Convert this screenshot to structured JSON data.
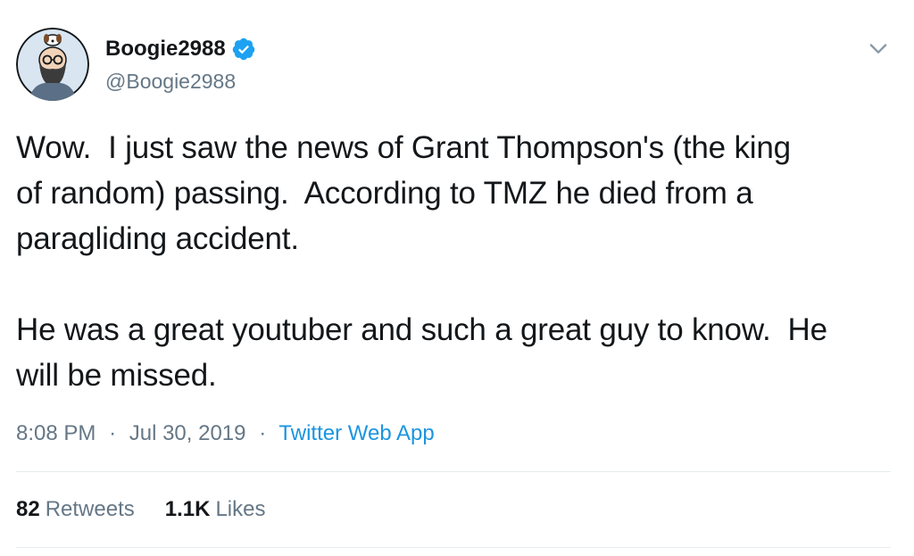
{
  "user": {
    "display_name": "Boogie2988",
    "handle": "@Boogie2988",
    "verified": true
  },
  "tweet": {
    "text": "Wow.  I just saw the news of Grant Thompson's (the king\nof random) passing.  According to TMZ he died from a\nparagliding accident.\n\nHe was a great youtuber and such a great guy to know.  He\nwill be missed.",
    "time": "8:08 PM",
    "date": "Jul 30, 2019",
    "source": "Twitter Web App",
    "separator": "·"
  },
  "stats": {
    "retweets_count": "82",
    "retweets_label": "Retweets",
    "likes_count": "1.1K",
    "likes_label": "Likes"
  },
  "colors": {
    "verified": "#1da1f2",
    "link": "#1b95e0",
    "secondary_text": "#657786",
    "primary_text": "#14171a",
    "divider": "#e6ecf0"
  },
  "icons": {
    "verified": "verified-badge-icon",
    "menu": "chevron-down-icon"
  }
}
